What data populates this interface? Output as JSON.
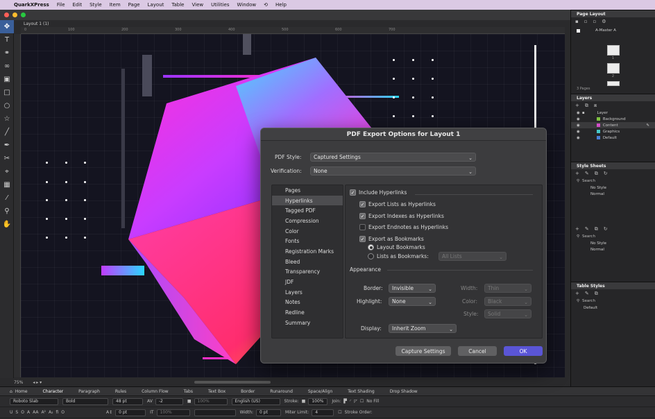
{
  "menubar": {
    "app": "QuarkXPress",
    "items": [
      "File",
      "Edit",
      "Style",
      "Item",
      "Page",
      "Layout",
      "Table",
      "View",
      "Utilities",
      "Window",
      "Help"
    ]
  },
  "doc": {
    "tab": "Layout 1 (1)",
    "zoom": "75%"
  },
  "ruler": {
    "marks": [
      "0",
      "100",
      "200",
      "300",
      "400",
      "500",
      "600",
      "700"
    ]
  },
  "right_panel": {
    "page_layout": {
      "title": "Page Layout",
      "master": "A-Master A",
      "page1": "1",
      "page2": "2",
      "pages_count": "3 Pages"
    },
    "layers": {
      "title": "Layers",
      "header": "Layer",
      "items": [
        {
          "name": "Background",
          "color": "#7fc241"
        },
        {
          "name": "Content",
          "color": "#d24fc8"
        },
        {
          "name": "Graphics",
          "color": "#45c7c7"
        },
        {
          "name": "Default",
          "color": "#4a7fd6"
        }
      ]
    },
    "style_sheets": {
      "title": "Style Sheets",
      "search": "Search",
      "para_items": [
        "No Style",
        "Normal"
      ],
      "char_items": [
        "No Style",
        "Normal"
      ]
    },
    "table_styles": {
      "title": "Table Styles",
      "search": "Search",
      "items": [
        "Default"
      ]
    }
  },
  "bottom_bar": {
    "tabs": [
      "Home",
      "Character",
      "Paragraph",
      "Rules",
      "Column Flow",
      "Tabs",
      "Text Box",
      "Border",
      "Runaround",
      "Space/Align",
      "Text Shading",
      "Drop Shadow"
    ],
    "row1": {
      "font": "Roboto Slab",
      "style": "Bold",
      "size": "48 pt",
      "tracking": "-2",
      "scale": "100%",
      "language": "English (US)",
      "stroke_label": "Stroke:",
      "stroke_pct": "100%",
      "join_label": "Join:",
      "no_fill": "No Fill"
    },
    "row2": {
      "baseline": "0 pt",
      "scale2": "100%",
      "width_label": "Width:",
      "width_val": "0 pt",
      "miter_label": "Miter Limit:",
      "miter_val": "4",
      "stroke_order_label": "Stroke Order:"
    }
  },
  "dialog": {
    "title": "PDF Export Options for Layout 1",
    "pdf_style_label": "PDF Style:",
    "pdf_style_value": "Captured Settings",
    "verification_label": "Verification:",
    "verification_value": "None",
    "nav": [
      "Pages",
      "Hyperlinks",
      "Tagged PDF",
      "Compression",
      "Color",
      "Fonts",
      "Registration Marks",
      "Bleed",
      "Transparency",
      "JDF",
      "Layers",
      "Notes",
      "Redline",
      "Summary"
    ],
    "selected_nav": "Hyperlinks",
    "include_hyperlinks": "Include Hyperlinks",
    "export_lists": "Export Lists as Hyperlinks",
    "export_indexes": "Export Indexes as Hyperlinks",
    "export_endnotes": "Export Endnotes as Hyperlinks",
    "export_bookmarks": "Export as Bookmarks",
    "layout_bookmarks": "Layout Bookmarks",
    "lists_bookmarks": "Lists as Bookmarks:",
    "all_lists": "All Lists",
    "appearance": "Appearance",
    "border_label": "Border:",
    "border_value": "Invisible",
    "width_label": "Width:",
    "width_value": "Thin",
    "highlight_label": "Highlight:",
    "highlight_value": "None",
    "color_label": "Color:",
    "color_value": "Black",
    "style_label": "Style:",
    "style_value": "Solid",
    "display_label": "Display:",
    "display_value": "Inherit Zoom",
    "capture_button": "Capture Settings",
    "cancel_button": "Cancel",
    "ok_button": "OK"
  }
}
